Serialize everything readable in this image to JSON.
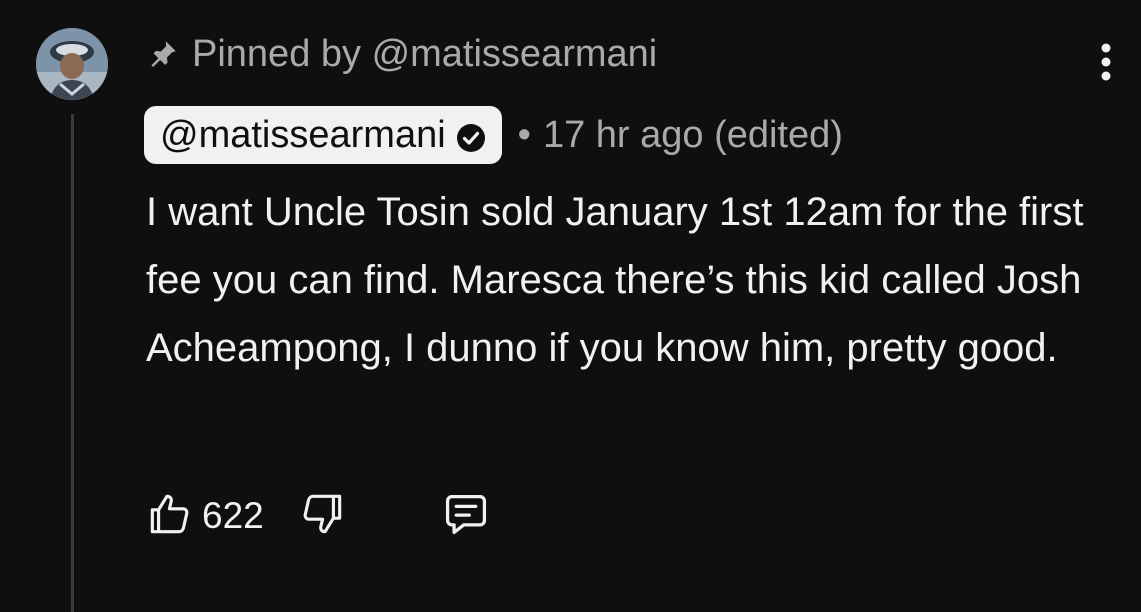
{
  "pinned": {
    "icon": "pin-icon",
    "text": "Pinned by @matissearmani"
  },
  "author": {
    "handle": "@matissearmani",
    "verified_icon": "verified-check-icon"
  },
  "meta": {
    "separator": "•",
    "timestamp": "17 hr ago (edited)"
  },
  "comment": {
    "text": "I want Uncle Tosin sold January 1st 12am for the first fee you can find. Maresca there’s this kid called Josh Acheampong, I dunno if you know him, pretty good."
  },
  "actions": {
    "like_icon": "thumbs-up-icon",
    "like_count": "622",
    "dislike_icon": "thumbs-down-icon",
    "reply_icon": "reply-comment-icon",
    "more_icon": "more-vertical-icon"
  },
  "colors": {
    "background": "#0f0f0f",
    "primary_text": "#f1f1f1",
    "secondary_text": "#aaaaaa",
    "chip_background": "#f1f1f1"
  }
}
